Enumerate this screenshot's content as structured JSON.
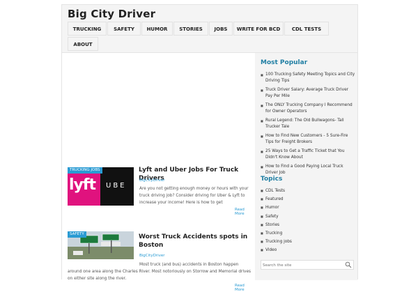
{
  "site": {
    "title": "Big City Driver"
  },
  "nav": {
    "items": [
      {
        "label": "TRUCKING"
      },
      {
        "label": "SAFETY"
      },
      {
        "label": "HUMOR"
      },
      {
        "label": "STORIES"
      },
      {
        "label": "JOBS"
      },
      {
        "label": "WRITE FOR BCD"
      },
      {
        "label": "CDL TESTS"
      },
      {
        "label": "ABOUT"
      }
    ]
  },
  "posts": [
    {
      "category": "TRUCKING JOBS",
      "title": "Lyft and Uber Jobs For Truck Drivers",
      "author": "BigCityDriver",
      "excerpt_lines": [
        "Are you not getting enough money or hours with your",
        "truck driving job? Consider driving for Uber & Lyft to",
        "increase your income! Here is how to get"
      ],
      "read_more": "Read More",
      "thumb": {
        "left_text": "lyft",
        "right_text": "UBE"
      }
    },
    {
      "category": "SAFETY",
      "title": "Worst Truck Accidents spots in Boston",
      "author": "BigCityDriver",
      "excerpt_lines": [
        "Most truck (and bus) accidents in Boston happen",
        "around one area along the Charles River. Most notoriously on Storrow and Memorial drives",
        "on either site along the river."
      ],
      "read_more": "Read More"
    }
  ],
  "sidebar": {
    "popular_title": "Most Popular",
    "popular": [
      {
        "text": "100 Trucking Safety Meeting Topics and City Driving Tips"
      },
      {
        "text": "Truck Driver Salary: Average Truck Driver Pay Per Mile"
      },
      {
        "text": "The ONLY Trucking Company I Recommend for Owner Operators"
      },
      {
        "text": "Rural Legend: The Old Bullwagons- Tall Trucker Tale"
      },
      {
        "text": "How to Find New Customers - 5 Sure-Fire Tips for Freight Brokers"
      },
      {
        "text": "25 Ways to Get a Traffic Ticket that You Didn't Know About"
      },
      {
        "text": "How to Find a Good Paying Local Truck Driver Job"
      }
    ],
    "topics_title": "Topics",
    "topics": [
      {
        "text": "CDL Tests"
      },
      {
        "text": "Featured"
      },
      {
        "text": "Humor"
      },
      {
        "text": "Safety"
      },
      {
        "text": "Stories"
      },
      {
        "text": "Trucking"
      },
      {
        "text": "Trucking jobs"
      },
      {
        "text": "Video"
      }
    ],
    "search_placeholder": "Search the site"
  },
  "colors": {
    "accent": "#2a9bd3",
    "heading": "#1f7ea3",
    "lyft": "#e0127e",
    "uber": "#111111"
  },
  "icons": {
    "search": "search-icon"
  }
}
